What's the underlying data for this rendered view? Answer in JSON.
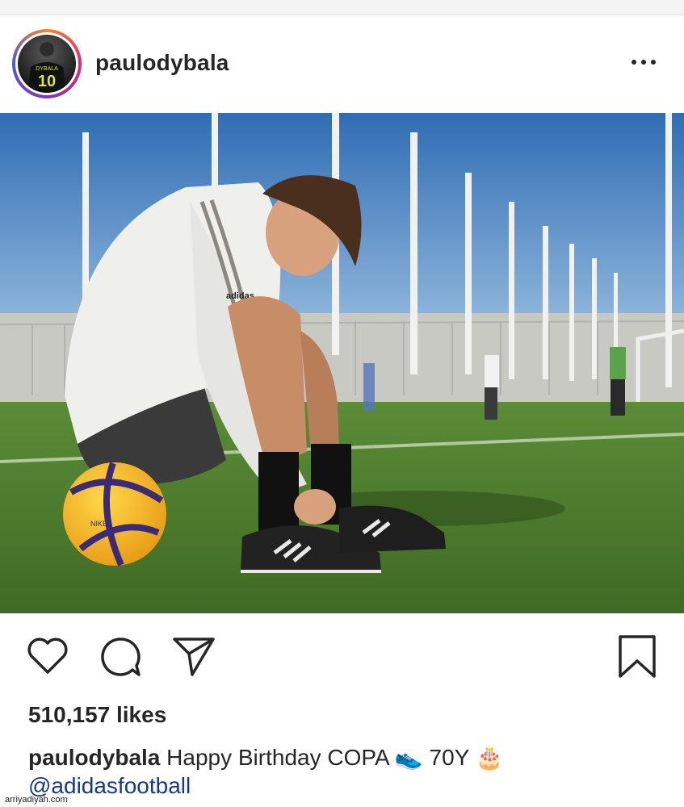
{
  "post": {
    "username": "paulodybala",
    "avatar_jersey_name": "DYBALA",
    "avatar_jersey_number": "10",
    "image_text": {
      "shirt_brand": "adidas",
      "ball_brand": "NIKE"
    },
    "likes": "510,157 likes",
    "caption": {
      "username": "paulodybala",
      "text_part1": "Happy Birthday COPA",
      "text_part2": "70Y",
      "shoe_emoji": "👟",
      "cake_emoji": "🎂",
      "mention": "@adidasfootball"
    }
  },
  "icons": {
    "more": "more-options-icon",
    "like": "heart-icon",
    "comment": "comment-icon",
    "share": "send-icon",
    "save": "bookmark-icon"
  },
  "watermark": "arriyadiyah.com",
  "colors": {
    "text": "#262626",
    "mention": "#173a82",
    "sky": "#3f77bb",
    "grass": "#4c7a2e"
  }
}
